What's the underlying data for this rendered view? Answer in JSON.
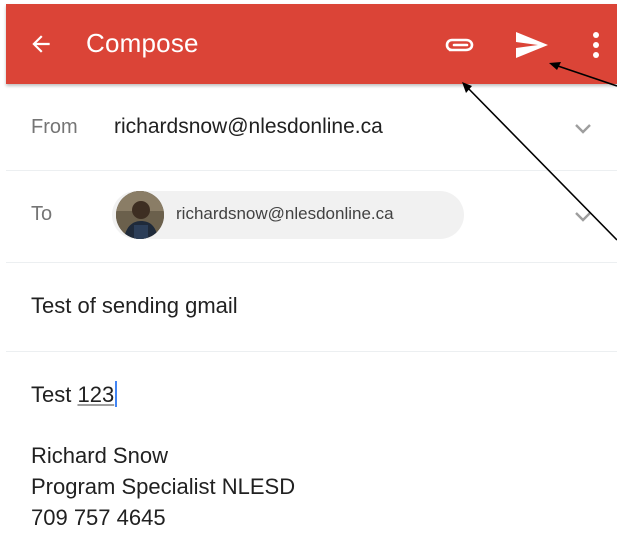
{
  "header": {
    "title": "Compose",
    "icons": [
      "arrow-back-icon",
      "paperclip-icon",
      "send-icon",
      "more-vert-icon"
    ],
    "color": "#db4437"
  },
  "from": {
    "label": "From",
    "value": "richardsnow@nlesdonline.ca"
  },
  "to": {
    "label": "To",
    "recipient": "richardsnow@nlesdonline.ca"
  },
  "subject": "Test of sending gmail",
  "body": {
    "prefix": "Test ",
    "underlined": "123",
    "signature": [
      "Richard Snow",
      "Program Specialist NLESD",
      "709 757 4645"
    ]
  },
  "colors": {
    "caret": "#4285f4",
    "annotation_arrows": "#000000"
  }
}
